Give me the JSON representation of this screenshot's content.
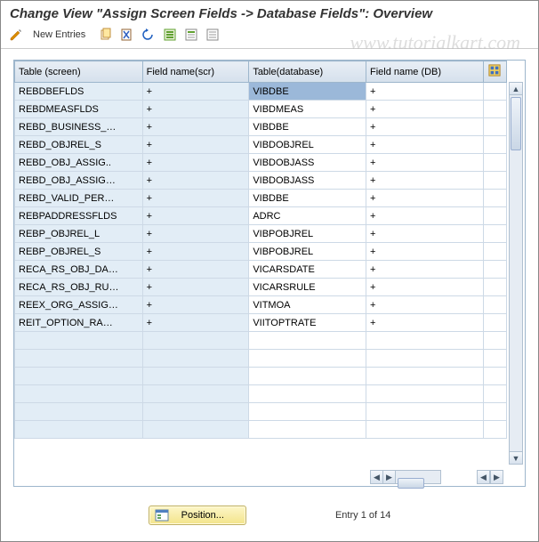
{
  "title": "Change View \"Assign Screen Fields -> Database Fields\": Overview",
  "watermark": "www.tutorialkart.com",
  "toolbar": {
    "new_entries": "New Entries"
  },
  "columns": {
    "c1": "Table (screen)",
    "c2": "Field name(scr)",
    "c3": "Table(database)",
    "c4": "Field name (DB)"
  },
  "rows": [
    {
      "c1": "REBDBEFLDS",
      "c2": "+",
      "c3": "VIBDBE",
      "c4": "+",
      "sel": "c3"
    },
    {
      "c1": "REBDMEASFLDS",
      "c2": "+",
      "c3": "VIBDMEAS",
      "c4": "+"
    },
    {
      "c1": "REBD_BUSINESS_…",
      "c2": "+",
      "c3": "VIBDBE",
      "c4": "+"
    },
    {
      "c1": "REBD_OBJREL_S",
      "c2": "+",
      "c3": "VIBDOBJREL",
      "c4": "+"
    },
    {
      "c1": "REBD_OBJ_ASSIG..",
      "c2": "+",
      "c3": "VIBDOBJASS",
      "c4": "+"
    },
    {
      "c1": "REBD_OBJ_ASSIG…",
      "c2": "+",
      "c3": "VIBDOBJASS",
      "c4": "+"
    },
    {
      "c1": "REBD_VALID_PER…",
      "c2": "+",
      "c3": "VIBDBE",
      "c4": "+"
    },
    {
      "c1": "REBPADDRESSFLDS",
      "c2": "+",
      "c3": "ADRC",
      "c4": "+"
    },
    {
      "c1": "REBP_OBJREL_L",
      "c2": "+",
      "c3": "VIBPOBJREL",
      "c4": "+"
    },
    {
      "c1": "REBP_OBJREL_S",
      "c2": "+",
      "c3": "VIBPOBJREL",
      "c4": "+"
    },
    {
      "c1": "RECA_RS_OBJ_DA…",
      "c2": "+",
      "c3": "VICARSDATE",
      "c4": "+"
    },
    {
      "c1": "RECA_RS_OBJ_RU…",
      "c2": "+",
      "c3": "VICARSRULE",
      "c4": "+"
    },
    {
      "c1": "REEX_ORG_ASSIG…",
      "c2": "+",
      "c3": "VITMOA",
      "c4": "+"
    },
    {
      "c1": "REIT_OPTION_RA…",
      "c2": "+",
      "c3": "VIITOPTRATE",
      "c4": "+"
    }
  ],
  "empty_rows": 6,
  "footer": {
    "position_label": "Position...",
    "entry_text": "Entry 1 of 14"
  }
}
